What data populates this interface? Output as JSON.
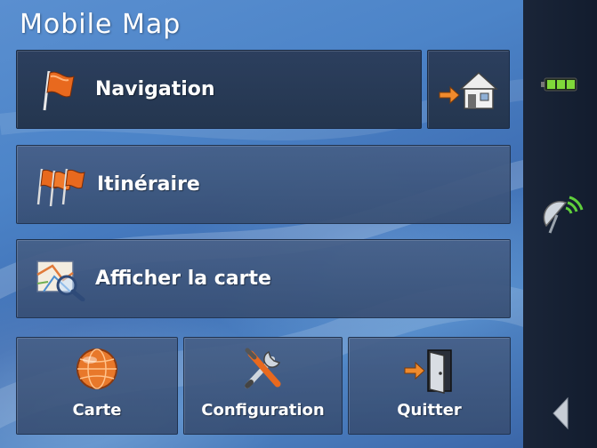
{
  "app": {
    "title": "Mobile Map"
  },
  "menu": {
    "navigation": {
      "label": "Navigation",
      "icon": "flag-icon"
    },
    "home": {
      "icon": "home-icon"
    },
    "itineraire": {
      "label": "Itinéraire",
      "icon": "flags-icon"
    },
    "afficher": {
      "label": "Afficher la carte",
      "icon": "map-magnifier-icon"
    },
    "carte": {
      "label": "Carte",
      "icon": "globe-icon"
    },
    "configuration": {
      "label": "Configuration",
      "icon": "tools-icon"
    },
    "quitter": {
      "label": "Quitter",
      "icon": "exit-door-icon"
    }
  },
  "sidebar": {
    "battery": {
      "icon": "battery-icon"
    },
    "gps": {
      "icon": "satellite-dish-icon"
    },
    "back": {
      "icon": "back-arrow-icon"
    }
  },
  "colors": {
    "flag": "#e8691e",
    "battery": "#7fd83a",
    "signal": "#5fcf3c"
  }
}
